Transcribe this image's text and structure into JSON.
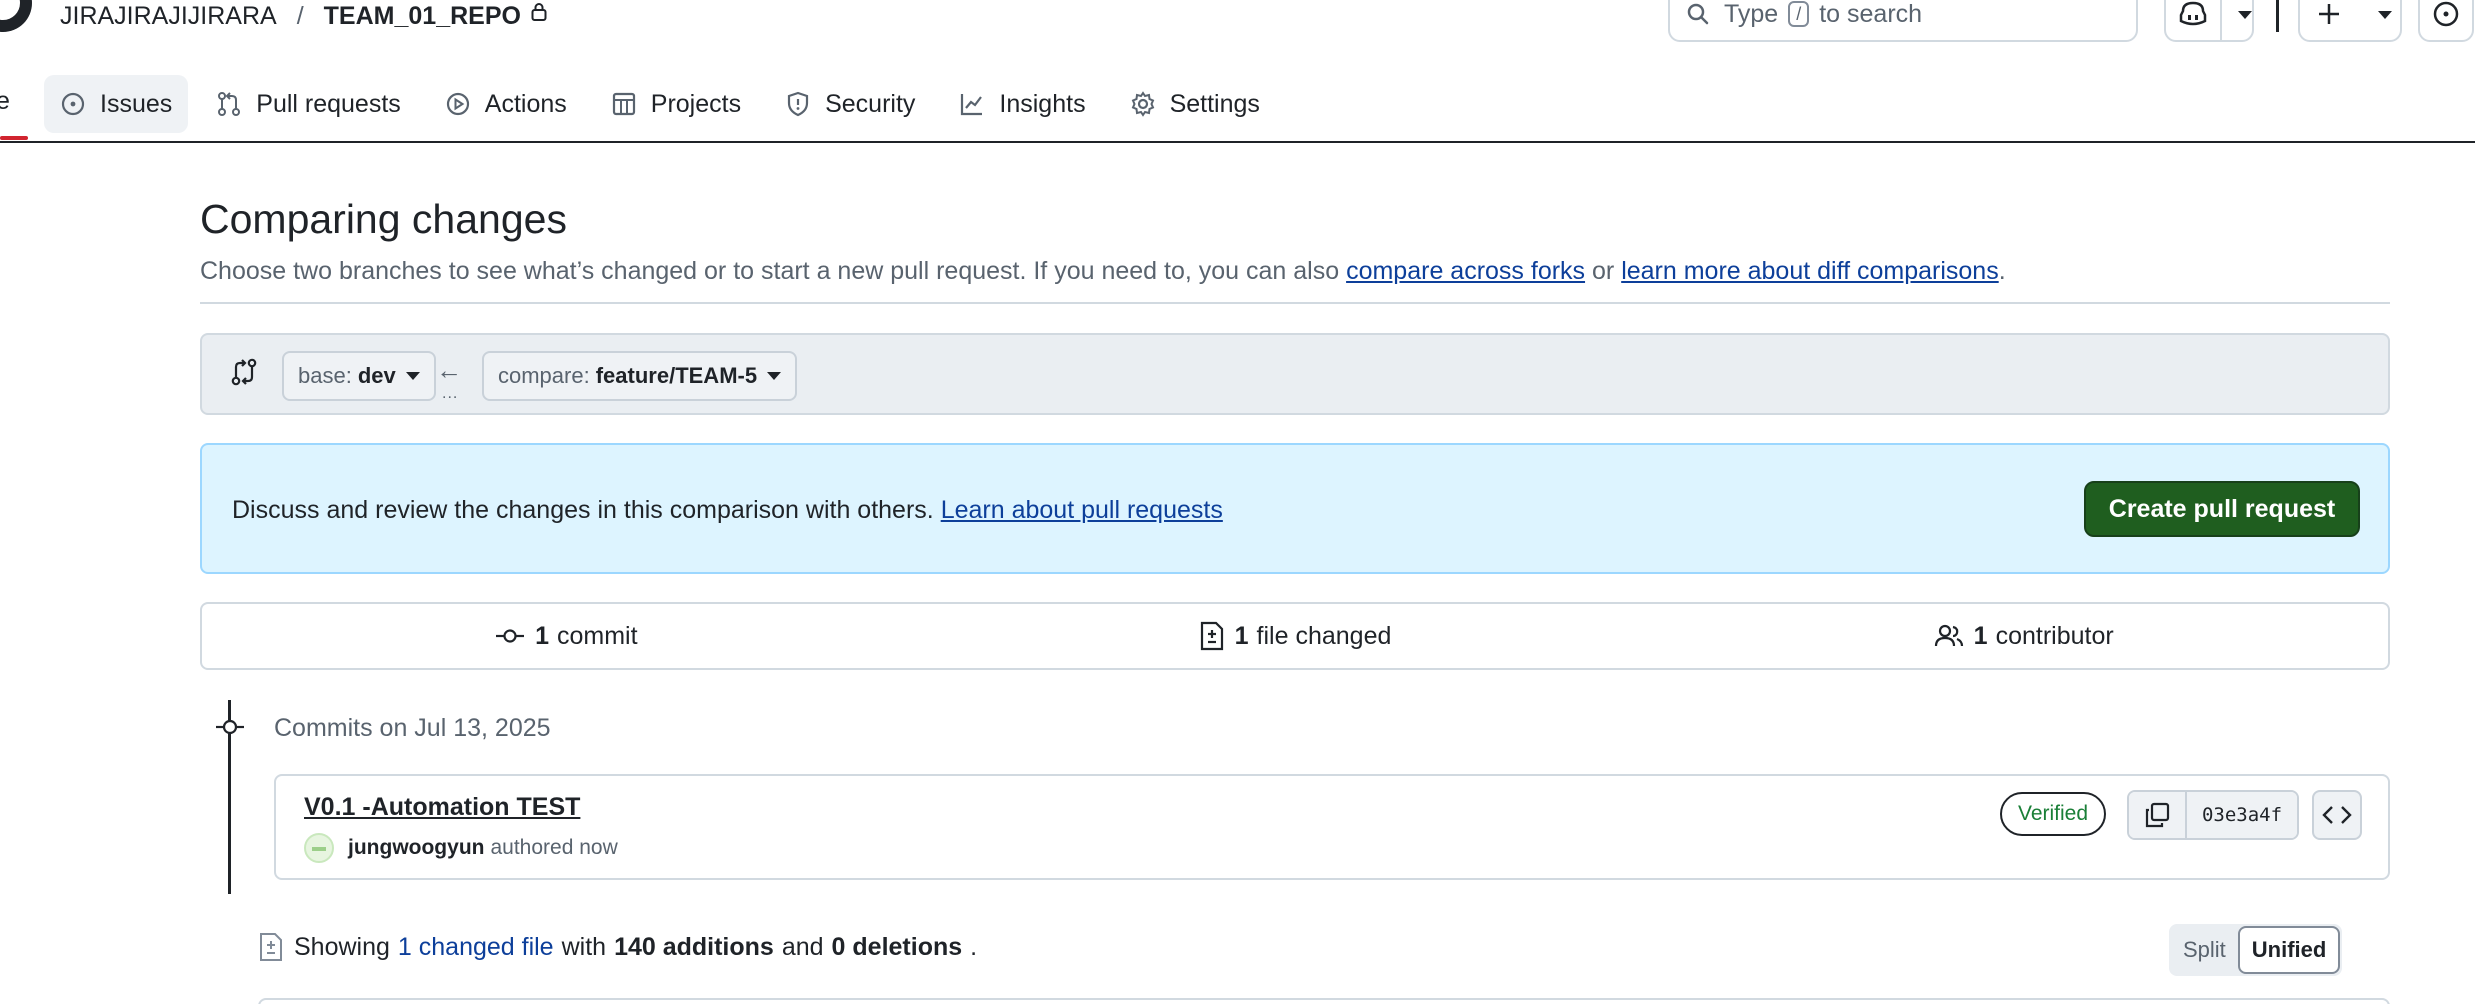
{
  "header": {
    "owner": "JIRAJIRAJIJIRARA",
    "separator": "/",
    "repo": "TEAM_01_REPO",
    "search": {
      "prefix": "Type",
      "key": "/",
      "suffix": "to search"
    }
  },
  "tabs": {
    "cut": "e",
    "items": [
      {
        "label": "Issues",
        "icon": "issue-opened-icon"
      },
      {
        "label": "Pull requests",
        "icon": "git-pull-request-icon"
      },
      {
        "label": "Actions",
        "icon": "play-icon"
      },
      {
        "label": "Projects",
        "icon": "table-icon"
      },
      {
        "label": "Security",
        "icon": "shield-icon"
      },
      {
        "label": "Insights",
        "icon": "graph-icon"
      },
      {
        "label": "Settings",
        "icon": "gear-icon"
      }
    ]
  },
  "page": {
    "title": "Comparing changes",
    "subtitle_prefix": "Choose two branches to see what’s changed or to start a new pull request. If you need to, you can also",
    "link_forks": "compare across forks",
    "or": "or",
    "link_learn": "learn more about diff comparisons",
    "period": "."
  },
  "range": {
    "base_label": "base:",
    "base_value": "dev",
    "arrow": "←",
    "dots": "...",
    "compare_label": "compare:",
    "compare_value": "feature/TEAM-5"
  },
  "flash": {
    "text": "Discuss and review the changes in this comparison with others.",
    "link": "Learn about pull requests",
    "button": "Create pull request"
  },
  "stats": {
    "commits_count": "1",
    "commits_label": "commit",
    "files_count": "1",
    "files_label": "file changed",
    "contributors_count": "1",
    "contributors_label": "contributor"
  },
  "commits": {
    "date": "Commits on Jul 13, 2025",
    "items": [
      {
        "title": "V0.1 -Automation TEST",
        "author": "jungwoogyun",
        "when": "authored now",
        "badge": "Verified",
        "sha": "03e3a4f"
      }
    ]
  },
  "summary": {
    "showing": "Showing",
    "changed_files": "1 changed file",
    "with": "with",
    "additions": "140 additions",
    "and": "and",
    "deletions": "0 deletions",
    "period": "."
  },
  "view_toggle": {
    "split": "Split",
    "unified": "Unified",
    "selected": "Unified"
  },
  "colors": {
    "primary_button": "#1f5e1f",
    "flash_bg": "#ddf4ff",
    "link": "#0d3f9a",
    "verified": "#1a7f37"
  }
}
